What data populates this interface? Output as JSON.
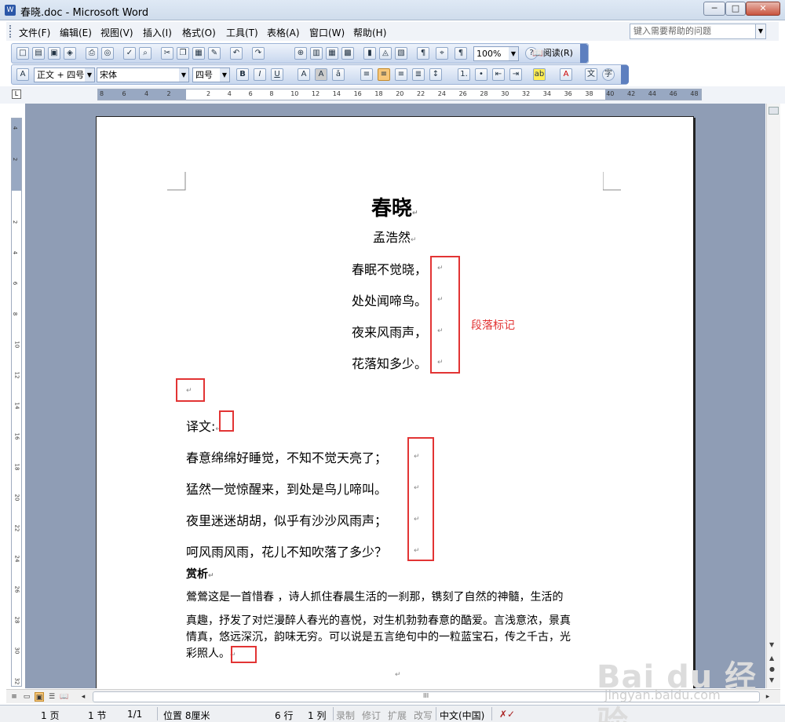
{
  "window": {
    "title": "春晓.doc - Microsoft Word",
    "icon": "word-icon",
    "minimize": "─",
    "maximize": "□",
    "close": "✕"
  },
  "menu": {
    "items": [
      "文件(F)",
      "编辑(E)",
      "视图(V)",
      "插入(I)",
      "格式(O)",
      "工具(T)",
      "表格(A)",
      "窗口(W)",
      "帮助(H)"
    ],
    "help_placeholder": "键入需要帮助的问题"
  },
  "toolbar": {
    "zoom": "100%",
    "read_label": "阅读(R)",
    "style": "正文 + 四号",
    "font": "宋体",
    "size": "四号"
  },
  "ruler": {
    "h_numbers": [
      "8",
      "6",
      "4",
      "2",
      "2",
      "4",
      "6",
      "8",
      "10",
      "12",
      "14",
      "16",
      "18",
      "20",
      "22",
      "24",
      "26",
      "28",
      "30",
      "32",
      "34",
      "36",
      "38",
      "40",
      "42",
      "44",
      "46",
      "48"
    ],
    "v_numbers": [
      "4",
      "2",
      "2",
      "4",
      "6",
      "8",
      "10",
      "12",
      "14",
      "16",
      "18",
      "20",
      "22",
      "24",
      "26",
      "28",
      "30",
      "32"
    ]
  },
  "document": {
    "title": "春晓",
    "author": "孟浩然",
    "lines": [
      "春眠不觉晓，",
      "处处闻啼鸟。",
      "夜来风雨声，",
      "花落知多少。"
    ],
    "trans_label": "译文:",
    "trans": [
      "春意绵绵好睡觉，不知不觉天亮了；",
      "猛然一觉惊醒来，到处是鸟儿啼叫。",
      "夜里迷迷胡胡，似乎有沙沙风雨声；",
      "呵风雨风雨，花儿不知吹落了多少？"
    ],
    "appreciation_label": "赏析",
    "appreciation": [
      "鶯鶯这是一首惜春  ，诗人抓住春晨生活的一刹那，镌刻了自然的神髓，生活的",
      "真趣，抒发了对烂漫醉人春光的喜悦，对生机勃勃春意的酷爱。言浅意浓，景真",
      "情真，悠远深沉，韵味无穷。可以说是五言绝句中的一粒蓝宝石，传之千古，光",
      "彩照人。"
    ],
    "para_mark": "↵",
    "annotation": "段落标记"
  },
  "status": {
    "page": "1 页",
    "section": "1 节",
    "pages": "1/1",
    "position": "位置 8厘米",
    "line": "6 行",
    "col": "1 列",
    "rec": "录制",
    "trk": "修订",
    "ext": "扩展",
    "ovr": "改写",
    "lang": "中文(中国)"
  },
  "watermark": {
    "main": "Bai du 经验",
    "sub": "jingyan.baidu.com"
  },
  "colors": {
    "annotation": "#e23434"
  }
}
